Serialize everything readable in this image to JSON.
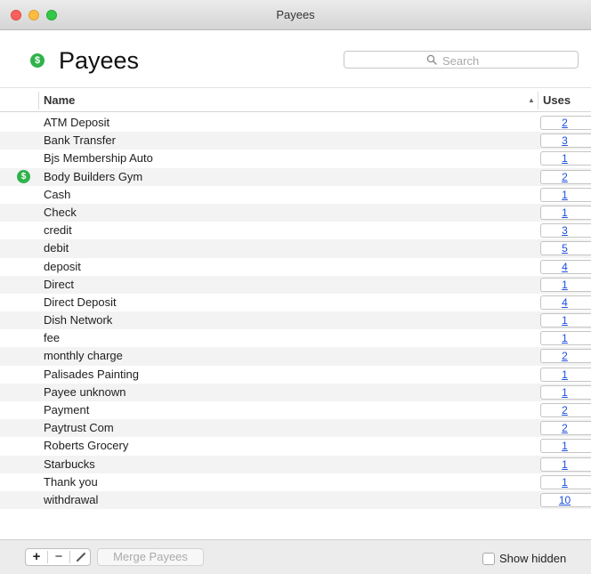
{
  "window": {
    "title": "Payees"
  },
  "header": {
    "title": "Payees",
    "icon": "dollar-circle-icon",
    "icon_glyph": "$",
    "accent": "#2fb24c"
  },
  "search": {
    "placeholder": "Search"
  },
  "table": {
    "columns": {
      "name": "Name",
      "uses": "Uses",
      "sort": "ascending",
      "sort_glyph": "▲"
    },
    "rows": [
      {
        "name": "ATM Deposit",
        "uses": "2"
      },
      {
        "name": "Bank Transfer",
        "uses": "3"
      },
      {
        "name": "Bjs Membership Auto",
        "uses": "1"
      },
      {
        "name": "Body Builders Gym",
        "uses": "2",
        "icon": "$"
      },
      {
        "name": "Cash",
        "uses": "1"
      },
      {
        "name": "Check",
        "uses": "1"
      },
      {
        "name": "credit",
        "uses": "3"
      },
      {
        "name": "debit",
        "uses": "5"
      },
      {
        "name": "deposit",
        "uses": "4"
      },
      {
        "name": "Direct",
        "uses": "1"
      },
      {
        "name": "Direct Deposit",
        "uses": "4"
      },
      {
        "name": "Dish Network",
        "uses": "1"
      },
      {
        "name": "fee",
        "uses": "1"
      },
      {
        "name": "monthly charge",
        "uses": "2"
      },
      {
        "name": "Palisades Painting",
        "uses": "1"
      },
      {
        "name": "Payee unknown",
        "uses": "1"
      },
      {
        "name": "Payment",
        "uses": "2"
      },
      {
        "name": "Paytrust Com",
        "uses": "2"
      },
      {
        "name": "Roberts Grocery",
        "uses": "1"
      },
      {
        "name": "Starbucks",
        "uses": "1"
      },
      {
        "name": "Thank you",
        "uses": "1"
      },
      {
        "name": "withdrawal",
        "uses": "10"
      }
    ]
  },
  "footer": {
    "add_label": "+",
    "remove_label": "−",
    "merge_label": "Merge Payees",
    "show_hidden_label": "Show hidden",
    "show_hidden_checked": false
  }
}
